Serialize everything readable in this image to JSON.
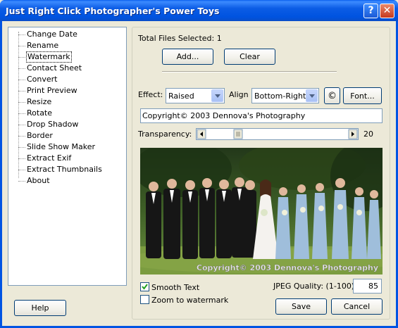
{
  "window": {
    "title": "Just Right Click Photographer's Power Toys",
    "help_glyph": "?",
    "close_glyph": "✕"
  },
  "sidebar": {
    "items": [
      {
        "label": "Change Date",
        "selected": false
      },
      {
        "label": "Rename",
        "selected": false
      },
      {
        "label": "Watermark",
        "selected": true
      },
      {
        "label": "Contact Sheet",
        "selected": false
      },
      {
        "label": "Convert",
        "selected": false
      },
      {
        "label": "Print Preview",
        "selected": false
      },
      {
        "label": "Resize",
        "selected": false
      },
      {
        "label": "Rotate",
        "selected": false
      },
      {
        "label": "Drop Shadow",
        "selected": false
      },
      {
        "label": "Border",
        "selected": false
      },
      {
        "label": "Slide Show Maker",
        "selected": false
      },
      {
        "label": "Extract Exif",
        "selected": false
      },
      {
        "label": "Extract Thumbnails",
        "selected": false
      },
      {
        "label": "About",
        "selected": false
      }
    ],
    "help_label": "Help"
  },
  "main": {
    "files_selected": "Total Files Selected: 1",
    "add_label": "Add...",
    "clear_label": "Clear",
    "effect_label": "Effect:",
    "effect_value": "Raised",
    "align_label": "Align",
    "align_value": "Bottom-Right",
    "copyright_button": "©",
    "font_label": "Font...",
    "watermark_text": "Copyright© 2003 Dennova's Photography",
    "transparency_label": "Transparency:",
    "transparency_value": "20",
    "preview_watermark": "Copyright© 2003 Dennova's Photography",
    "smooth_text_label": "Smooth Text",
    "smooth_text_checked": true,
    "zoom_label": "Zoom to watermark",
    "zoom_checked": false,
    "jpeg_label": "JPEG Quality: (1-100)",
    "jpeg_value": "85",
    "save_label": "Save",
    "cancel_label": "Cancel"
  },
  "colors": {
    "titlebar": "#0054e3",
    "panel": "#ece9d8",
    "input_border": "#7f9db9"
  }
}
